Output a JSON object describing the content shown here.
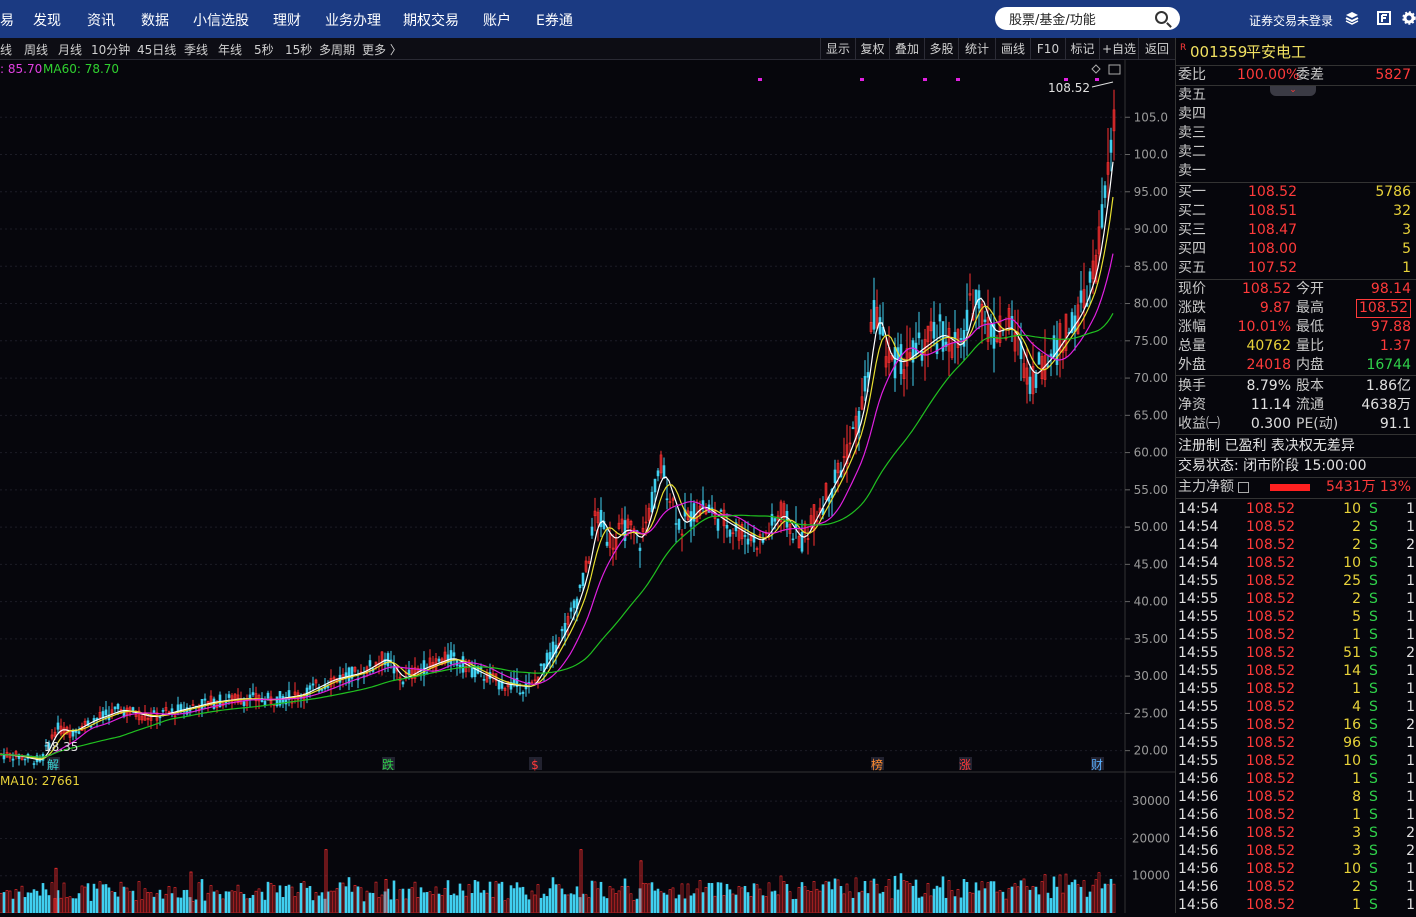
{
  "topnav": {
    "items": [
      "易",
      "发现",
      "资讯",
      "数据",
      "小信选股",
      "理财",
      "业务办理",
      "期权交易",
      "账户",
      "E券通"
    ],
    "search_placeholder": "股票/基金/功能",
    "login_status": "证券交易未登录"
  },
  "period_bar": {
    "periods": [
      "线",
      "周线",
      "月线",
      "10分钟",
      "45日线",
      "季线",
      "年线",
      "5秒",
      "15秒",
      "多周期",
      "更多 〉"
    ],
    "tools": [
      "显示",
      "复权",
      "叠加",
      "多股",
      "统计",
      "画线",
      "F10",
      "标记",
      "+自选",
      "返回"
    ]
  },
  "ma_legend": {
    "ma20": ": 85.70",
    "ma60": "MA60: 78.70"
  },
  "vol_legend": "MA10: 27661",
  "chart_data": {
    "type": "candlestick",
    "price_axis_ticks": [
      "105.0",
      "100.0",
      "95.00",
      "90.00",
      "85.00",
      "80.00",
      "75.00",
      "70.00",
      "65.00",
      "60.00",
      "55.00",
      "50.00",
      "45.00",
      "40.00",
      "35.00",
      "30.00",
      "25.00",
      "20.00"
    ],
    "volume_axis_ticks": [
      "30000",
      "20000",
      "10000"
    ],
    "ylim": [
      17,
      110
    ],
    "high_label": "108.52",
    "low_label": "18.35",
    "close_path": [
      [
        0,
        19.5
      ],
      [
        20,
        19.2
      ],
      [
        40,
        18.6
      ],
      [
        55,
        23
      ],
      [
        70,
        22.5
      ],
      [
        90,
        24
      ],
      [
        120,
        25.5
      ],
      [
        150,
        24.5
      ],
      [
        180,
        25.5
      ],
      [
        210,
        26.5
      ],
      [
        240,
        27.0
      ],
      [
        270,
        26.8
      ],
      [
        300,
        27.5
      ],
      [
        330,
        29.5
      ],
      [
        360,
        30.5
      ],
      [
        385,
        32.5
      ],
      [
        400,
        29.5
      ],
      [
        420,
        31
      ],
      [
        450,
        32.5
      ],
      [
        470,
        31
      ],
      [
        500,
        29
      ],
      [
        530,
        28.5
      ],
      [
        550,
        33
      ],
      [
        570,
        38
      ],
      [
        585,
        44
      ],
      [
        595,
        52
      ],
      [
        610,
        48
      ],
      [
        625,
        50
      ],
      [
        640,
        48
      ],
      [
        660,
        58
      ],
      [
        680,
        50
      ],
      [
        700,
        53
      ],
      [
        720,
        51
      ],
      [
        745,
        49
      ],
      [
        760,
        48
      ],
      [
        780,
        52
      ],
      [
        800,
        48
      ],
      [
        820,
        53
      ],
      [
        840,
        58
      ],
      [
        860,
        65
      ],
      [
        875,
        80
      ],
      [
        885,
        73
      ],
      [
        900,
        72
      ],
      [
        920,
        74
      ],
      [
        940,
        76
      ],
      [
        960,
        74
      ],
      [
        975,
        82
      ],
      [
        990,
        76
      ],
      [
        1010,
        77
      ],
      [
        1030,
        70
      ],
      [
        1050,
        73
      ],
      [
        1065,
        76
      ],
      [
        1080,
        79
      ],
      [
        1095,
        85
      ],
      [
        1105,
        95
      ],
      [
        1110,
        100
      ],
      [
        1115,
        108.52
      ]
    ],
    "ma_series": [
      {
        "name": "",
        "color": "#ffffff",
        "lag": 3,
        "smooth": 1
      },
      {
        "name": "",
        "color": "#e8e030",
        "lag": 6,
        "smooth": 2
      },
      {
        "name": "MA20",
        "color": "#e020e0",
        "lag": 14,
        "smooth": 3
      },
      {
        "name": "MA60",
        "color": "#20c020",
        "lag": 40,
        "smooth": 6
      }
    ],
    "volume": [
      {
        "x": 55,
        "v": 12000
      },
      {
        "x": 190,
        "v": 11000
      },
      {
        "x": 325,
        "v": 17000
      },
      {
        "x": 385,
        "v": 9000
      },
      {
        "x": 580,
        "v": 17000
      },
      {
        "x": 640,
        "v": 14000
      }
    ],
    "markers": [
      {
        "text": "解",
        "color": "#3bd6d6",
        "x": 53
      },
      {
        "text": "跌",
        "color": "#2fd04a",
        "x": 388
      },
      {
        "text": "$",
        "color": "#ff3a3a",
        "x": 535
      },
      {
        "text": "榜",
        "color": "#ff8c30",
        "x": 877
      },
      {
        "text": "涨",
        "color": "#ff3a3a",
        "x": 965
      },
      {
        "text": "财",
        "color": "#5ab0ff",
        "x": 1097
      }
    ]
  },
  "quote": {
    "code": "001359",
    "name": "平安电工",
    "weibi_label": "委比",
    "weibi": "100.00%",
    "weicha_label": "委差",
    "weicha": "5827",
    "sell": [
      {
        "label": "卖五",
        "price": "",
        "vol": ""
      },
      {
        "label": "卖四",
        "price": "",
        "vol": ""
      },
      {
        "label": "卖三",
        "price": "",
        "vol": ""
      },
      {
        "label": "卖二",
        "price": "",
        "vol": ""
      },
      {
        "label": "卖一",
        "price": "",
        "vol": ""
      }
    ],
    "buy": [
      {
        "label": "买一",
        "price": "108.52",
        "vol": "5786"
      },
      {
        "label": "买二",
        "price": "108.51",
        "vol": "32"
      },
      {
        "label": "买三",
        "price": "108.47",
        "vol": "3"
      },
      {
        "label": "买四",
        "price": "108.00",
        "vol": "5"
      },
      {
        "label": "买五",
        "price": "107.52",
        "vol": "1"
      }
    ],
    "stats": [
      [
        "现价",
        "108.52",
        "今开",
        "98.14"
      ],
      [
        "涨跌",
        "9.87",
        "最高",
        "108.52"
      ],
      [
        "涨幅",
        "10.01%",
        "最低",
        "97.88"
      ],
      [
        "总量",
        "40762",
        "量比",
        "1.37"
      ],
      [
        "外盘",
        "24018",
        "内盘",
        "16744"
      ]
    ],
    "stats2": [
      [
        "换手",
        "8.79%",
        "股本",
        "1.86亿"
      ],
      [
        "净资",
        "11.14",
        "流通",
        "4638万"
      ],
      [
        "收益㈠",
        "0.300",
        "PE(动)",
        "91.1"
      ]
    ],
    "tags": "注册制 已盈利 表决权无差异",
    "trade_status": "交易状态: 闭市阶段 15:00:00",
    "main_flow_label": "主力净额",
    "main_flow_value": "5431万",
    "main_flow_pct": "13%"
  },
  "ticks": [
    [
      "14:54",
      "108.52",
      "10",
      "S",
      "1"
    ],
    [
      "14:54",
      "108.52",
      "2",
      "S",
      "1"
    ],
    [
      "14:54",
      "108.52",
      "2",
      "S",
      "2"
    ],
    [
      "14:54",
      "108.52",
      "10",
      "S",
      "1"
    ],
    [
      "14:55",
      "108.52",
      "25",
      "S",
      "1"
    ],
    [
      "14:55",
      "108.52",
      "2",
      "S",
      "1"
    ],
    [
      "14:55",
      "108.52",
      "5",
      "S",
      "1"
    ],
    [
      "14:55",
      "108.52",
      "1",
      "S",
      "1"
    ],
    [
      "14:55",
      "108.52",
      "51",
      "S",
      "2"
    ],
    [
      "14:55",
      "108.52",
      "14",
      "S",
      "1"
    ],
    [
      "14:55",
      "108.52",
      "1",
      "S",
      "1"
    ],
    [
      "14:55",
      "108.52",
      "4",
      "S",
      "1"
    ],
    [
      "14:55",
      "108.52",
      "16",
      "S",
      "2"
    ],
    [
      "14:55",
      "108.52",
      "96",
      "S",
      "1"
    ],
    [
      "14:55",
      "108.52",
      "10",
      "S",
      "1"
    ],
    [
      "14:56",
      "108.52",
      "1",
      "S",
      "1"
    ],
    [
      "14:56",
      "108.52",
      "8",
      "S",
      "1"
    ],
    [
      "14:56",
      "108.52",
      "1",
      "S",
      "1"
    ],
    [
      "14:56",
      "108.52",
      "3",
      "S",
      "2"
    ],
    [
      "14:56",
      "108.52",
      "3",
      "S",
      "2"
    ],
    [
      "14:56",
      "108.52",
      "10",
      "S",
      "1"
    ],
    [
      "14:56",
      "108.52",
      "2",
      "S",
      "1"
    ],
    [
      "14:56",
      "108.52",
      "1",
      "S",
      "1"
    ]
  ]
}
